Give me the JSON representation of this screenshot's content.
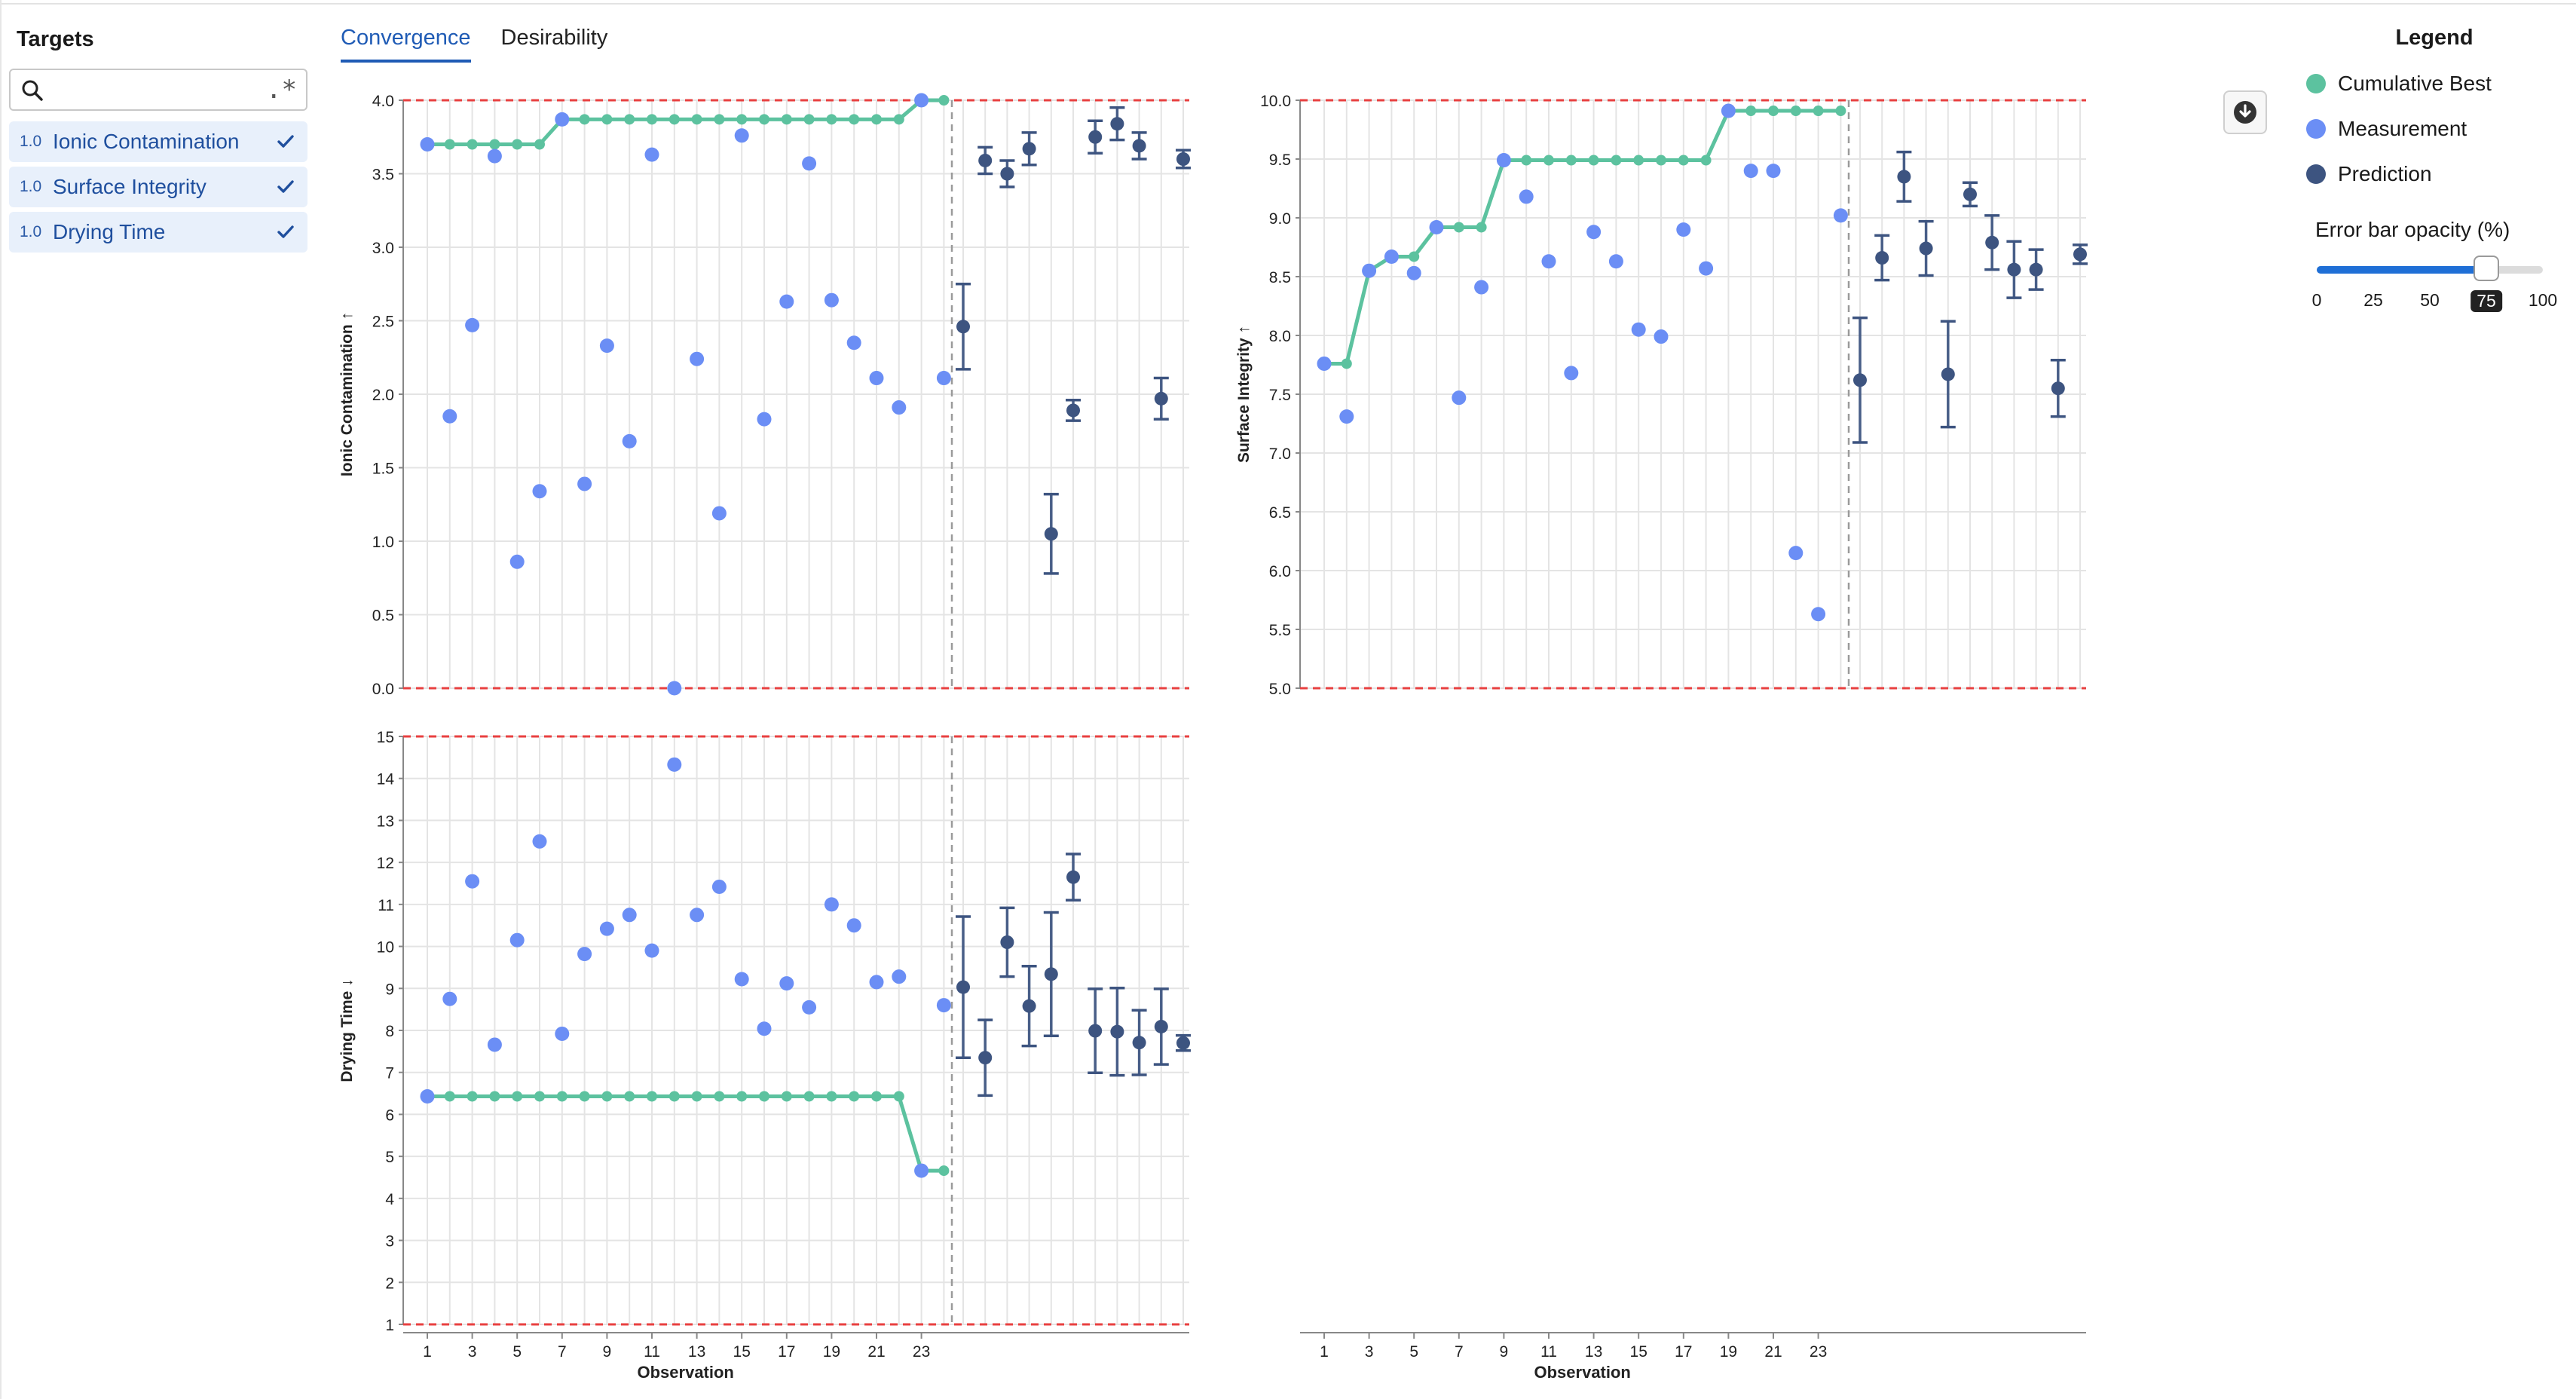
{
  "sidebar": {
    "title": "Targets",
    "search": {
      "value": "",
      "placeholder": "",
      "regex_label": ".*"
    },
    "targets": [
      {
        "weight": "1.0",
        "name": "Ionic Contamination",
        "checked": true
      },
      {
        "weight": "1.0",
        "name": "Surface Integrity",
        "checked": true
      },
      {
        "weight": "1.0",
        "name": "Drying Time",
        "checked": true
      }
    ]
  },
  "tabs": [
    {
      "label": "Convergence",
      "active": true
    },
    {
      "label": "Desirability",
      "active": false
    }
  ],
  "legend": {
    "title": "Legend",
    "items": [
      {
        "label": "Cumulative Best",
        "color": "#5cc29f"
      },
      {
        "label": "Measurement",
        "color": "#6b8ef5"
      },
      {
        "label": "Prediction",
        "color": "#3d5480"
      }
    ],
    "error_bar_opacity": {
      "label": "Error bar opacity (%)",
      "value": 75,
      "ticks": [
        "0",
        "25",
        "50",
        "75",
        "100"
      ]
    }
  },
  "toolbar": {
    "download_icon": "download-icon"
  },
  "colors": {
    "best": "#5cc29f",
    "measurement": "#6b8ef5",
    "prediction": "#3d5480",
    "bound": "#e84040",
    "accent": "#1f5bb5"
  },
  "chart_data": [
    {
      "type": "scatter",
      "ylabel": "Ionic Contamination ↑",
      "xlabel": "",
      "ylim": [
        0,
        4
      ],
      "yticks": [
        "0.0",
        "0.5",
        "1.0",
        "1.5",
        "2.0",
        "2.5",
        "3.0",
        "3.5",
        "4.0"
      ],
      "xticks": [],
      "bounds": [
        0,
        4
      ],
      "measurements": [
        [
          1,
          3.7
        ],
        [
          2,
          1.85
        ],
        [
          3,
          2.47
        ],
        [
          4,
          3.62
        ],
        [
          5,
          0.86
        ],
        [
          6,
          1.34
        ],
        [
          7,
          3.87
        ],
        [
          8,
          1.39
        ],
        [
          9,
          2.33
        ],
        [
          10,
          1.68
        ],
        [
          11,
          3.63
        ],
        [
          12,
          0.0
        ],
        [
          13,
          2.24
        ],
        [
          14,
          1.19
        ],
        [
          15,
          3.76
        ],
        [
          16,
          1.83
        ],
        [
          17,
          2.63
        ],
        [
          18,
          3.57
        ],
        [
          19,
          2.64
        ],
        [
          20,
          2.35
        ],
        [
          21,
          2.11
        ],
        [
          22,
          1.91
        ],
        [
          23,
          4.0
        ],
        [
          24,
          2.11
        ]
      ],
      "best": [
        [
          1,
          3.7
        ],
        [
          2,
          3.7
        ],
        [
          3,
          3.7
        ],
        [
          4,
          3.7
        ],
        [
          5,
          3.7
        ],
        [
          6,
          3.7
        ],
        [
          7,
          3.87
        ],
        [
          8,
          3.87
        ],
        [
          9,
          3.87
        ],
        [
          10,
          3.87
        ],
        [
          11,
          3.87
        ],
        [
          12,
          3.87
        ],
        [
          13,
          3.87
        ],
        [
          14,
          3.87
        ],
        [
          15,
          3.87
        ],
        [
          16,
          3.87
        ],
        [
          17,
          3.87
        ],
        [
          18,
          3.87
        ],
        [
          19,
          3.87
        ],
        [
          20,
          3.87
        ],
        [
          21,
          3.87
        ],
        [
          22,
          3.87
        ],
        [
          23,
          4.0
        ],
        [
          24,
          4.0
        ]
      ],
      "predictions": [
        [
          2.46,
          0.29
        ],
        [
          3.59,
          0.09
        ],
        [
          3.5,
          0.09
        ],
        [
          3.67,
          0.11
        ],
        [
          1.05,
          0.27
        ],
        [
          1.89,
          0.07
        ],
        [
          3.75,
          0.11
        ],
        [
          3.84,
          0.11
        ],
        [
          3.69,
          0.09
        ],
        [
          1.97,
          0.14
        ],
        [
          3.6,
          0.06
        ]
      ]
    },
    {
      "type": "scatter",
      "ylabel": "Surface Integrity ↑",
      "xlabel": "Observation",
      "ylim": [
        5,
        10
      ],
      "yticks": [
        "5.0",
        "5.5",
        "6.0",
        "6.5",
        "7.0",
        "7.5",
        "8.0",
        "8.5",
        "9.0",
        "9.5",
        "10.0"
      ],
      "xticks": [
        "1",
        "3",
        "5",
        "7",
        "9",
        "11",
        "13",
        "15",
        "17",
        "19",
        "21",
        "23"
      ],
      "bounds": [
        5,
        10
      ],
      "measurements": [
        [
          1,
          7.76
        ],
        [
          2,
          7.31
        ],
        [
          3,
          8.55
        ],
        [
          4,
          8.67
        ],
        [
          5,
          8.53
        ],
        [
          6,
          8.92
        ],
        [
          7,
          7.47
        ],
        [
          8,
          8.41
        ],
        [
          9,
          9.49
        ],
        [
          10,
          9.18
        ],
        [
          11,
          8.63
        ],
        [
          12,
          7.68
        ],
        [
          13,
          8.88
        ],
        [
          14,
          8.63
        ],
        [
          15,
          8.05
        ],
        [
          16,
          7.99
        ],
        [
          17,
          8.9
        ],
        [
          18,
          8.57
        ],
        [
          19,
          9.91
        ],
        [
          20,
          9.4
        ],
        [
          21,
          9.4
        ],
        [
          22,
          6.15
        ],
        [
          23,
          5.63
        ],
        [
          24,
          9.02
        ]
      ],
      "best": [
        [
          1,
          7.76
        ],
        [
          2,
          7.76
        ],
        [
          3,
          8.55
        ],
        [
          4,
          8.67
        ],
        [
          5,
          8.67
        ],
        [
          6,
          8.92
        ],
        [
          7,
          8.92
        ],
        [
          8,
          8.92
        ],
        [
          9,
          9.49
        ],
        [
          10,
          9.49
        ],
        [
          11,
          9.49
        ],
        [
          12,
          9.49
        ],
        [
          13,
          9.49
        ],
        [
          14,
          9.49
        ],
        [
          15,
          9.49
        ],
        [
          16,
          9.49
        ],
        [
          17,
          9.49
        ],
        [
          18,
          9.49
        ],
        [
          19,
          9.91
        ],
        [
          20,
          9.91
        ],
        [
          21,
          9.91
        ],
        [
          22,
          9.91
        ],
        [
          23,
          9.91
        ],
        [
          24,
          9.91
        ]
      ],
      "predictions": [
        [
          7.62,
          0.53
        ],
        [
          8.66,
          0.19
        ],
        [
          9.35,
          0.21
        ],
        [
          8.74,
          0.23
        ],
        [
          7.67,
          0.45
        ],
        [
          9.2,
          0.1
        ],
        [
          8.79,
          0.23
        ],
        [
          8.56,
          0.24
        ],
        [
          8.56,
          0.17
        ],
        [
          7.55,
          0.24
        ],
        [
          8.69,
          0.08
        ]
      ]
    },
    {
      "type": "scatter",
      "ylabel": "Drying Time ↓",
      "xlabel": "Observation",
      "ylim": [
        1,
        15
      ],
      "yticks": [
        "1",
        "2",
        "3",
        "4",
        "5",
        "6",
        "7",
        "8",
        "9",
        "10",
        "11",
        "12",
        "13",
        "14",
        "15"
      ],
      "xticks": [
        "1",
        "3",
        "5",
        "7",
        "9",
        "11",
        "13",
        "15",
        "17",
        "19",
        "21",
        "23"
      ],
      "bounds": [
        1,
        15
      ],
      "measurements": [
        [
          1,
          6.43
        ],
        [
          2,
          8.75
        ],
        [
          3,
          11.55
        ],
        [
          4,
          7.66
        ],
        [
          5,
          10.15
        ],
        [
          6,
          12.5
        ],
        [
          7,
          7.92
        ],
        [
          8,
          9.82
        ],
        [
          9,
          10.42
        ],
        [
          10,
          10.75
        ],
        [
          11,
          9.9
        ],
        [
          12,
          14.33
        ],
        [
          13,
          10.75
        ],
        [
          14,
          11.42
        ],
        [
          15,
          9.22
        ],
        [
          16,
          8.04
        ],
        [
          17,
          9.12
        ],
        [
          18,
          8.55
        ],
        [
          19,
          11.0
        ],
        [
          20,
          10.5
        ],
        [
          21,
          9.15
        ],
        [
          22,
          9.28
        ],
        [
          23,
          4.66
        ],
        [
          24,
          8.6
        ]
      ],
      "best": [
        [
          1,
          6.43
        ],
        [
          2,
          6.43
        ],
        [
          3,
          6.43
        ],
        [
          4,
          6.43
        ],
        [
          5,
          6.43
        ],
        [
          6,
          6.43
        ],
        [
          7,
          6.43
        ],
        [
          8,
          6.43
        ],
        [
          9,
          6.43
        ],
        [
          10,
          6.43
        ],
        [
          11,
          6.43
        ],
        [
          12,
          6.43
        ],
        [
          13,
          6.43
        ],
        [
          14,
          6.43
        ],
        [
          15,
          6.43
        ],
        [
          16,
          6.43
        ],
        [
          17,
          6.43
        ],
        [
          18,
          6.43
        ],
        [
          19,
          6.43
        ],
        [
          20,
          6.43
        ],
        [
          21,
          6.43
        ],
        [
          22,
          6.43
        ],
        [
          23,
          4.66
        ],
        [
          24,
          4.66
        ]
      ],
      "predictions": [
        [
          9.03,
          1.68
        ],
        [
          7.35,
          0.9
        ],
        [
          10.1,
          0.82
        ],
        [
          8.58,
          0.95
        ],
        [
          9.34,
          1.47
        ],
        [
          11.65,
          0.55
        ],
        [
          7.99,
          1.0
        ],
        [
          7.97,
          1.04
        ],
        [
          7.71,
          0.77
        ],
        [
          8.09,
          0.9
        ],
        [
          7.7,
          0.18
        ]
      ]
    }
  ]
}
